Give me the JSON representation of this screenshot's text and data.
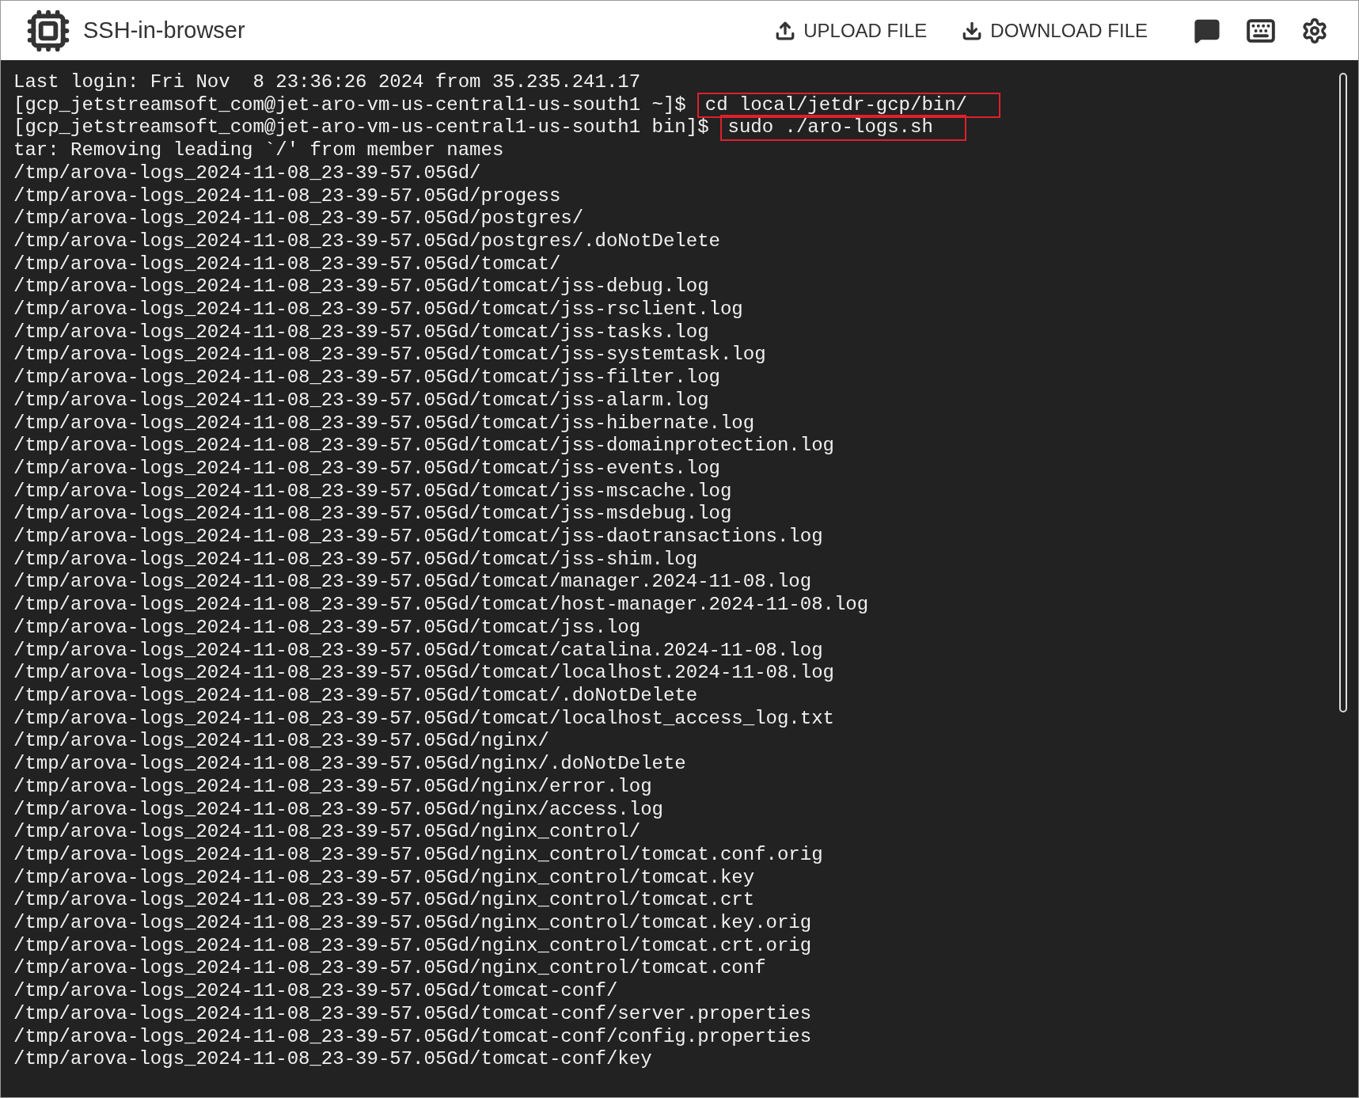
{
  "header": {
    "title": "SSH-in-browser",
    "actions": [
      {
        "kind": "upload",
        "label": "UPLOAD FILE"
      },
      {
        "kind": "download",
        "label": "DOWNLOAD FILE"
      }
    ],
    "icon_buttons": [
      {
        "kind": "feedback"
      },
      {
        "kind": "keyboard"
      },
      {
        "kind": "settings"
      }
    ]
  },
  "terminal": {
    "lines": [
      {
        "kind": "output",
        "text": "Last login: Fri Nov  8 23:36:26 2024 from 35.235.241.17"
      },
      {
        "kind": "prompt",
        "prompt": "[gcp_jetstreamsoft_com@jet-aro-vm-us-central1-us-south1 ~]$",
        "command": "cd local/jetdr-gcp/bin/",
        "highlighted": true
      },
      {
        "kind": "prompt",
        "prompt": "[gcp_jetstreamsoft_com@jet-aro-vm-us-central1-us-south1 bin]$",
        "command": "sudo ./aro-logs.sh",
        "highlighted": true
      },
      {
        "kind": "output",
        "text": "tar: Removing leading `/' from member names"
      },
      {
        "kind": "output",
        "text": "/tmp/arova-logs_2024-11-08_23-39-57.05Gd/"
      },
      {
        "kind": "output",
        "text": "/tmp/arova-logs_2024-11-08_23-39-57.05Gd/progess"
      },
      {
        "kind": "output",
        "text": "/tmp/arova-logs_2024-11-08_23-39-57.05Gd/postgres/"
      },
      {
        "kind": "output",
        "text": "/tmp/arova-logs_2024-11-08_23-39-57.05Gd/postgres/.doNotDelete"
      },
      {
        "kind": "output",
        "text": "/tmp/arova-logs_2024-11-08_23-39-57.05Gd/tomcat/"
      },
      {
        "kind": "output",
        "text": "/tmp/arova-logs_2024-11-08_23-39-57.05Gd/tomcat/jss-debug.log"
      },
      {
        "kind": "output",
        "text": "/tmp/arova-logs_2024-11-08_23-39-57.05Gd/tomcat/jss-rsclient.log"
      },
      {
        "kind": "output",
        "text": "/tmp/arova-logs_2024-11-08_23-39-57.05Gd/tomcat/jss-tasks.log"
      },
      {
        "kind": "output",
        "text": "/tmp/arova-logs_2024-11-08_23-39-57.05Gd/tomcat/jss-systemtask.log"
      },
      {
        "kind": "output",
        "text": "/tmp/arova-logs_2024-11-08_23-39-57.05Gd/tomcat/jss-filter.log"
      },
      {
        "kind": "output",
        "text": "/tmp/arova-logs_2024-11-08_23-39-57.05Gd/tomcat/jss-alarm.log"
      },
      {
        "kind": "output",
        "text": "/tmp/arova-logs_2024-11-08_23-39-57.05Gd/tomcat/jss-hibernate.log"
      },
      {
        "kind": "output",
        "text": "/tmp/arova-logs_2024-11-08_23-39-57.05Gd/tomcat/jss-domainprotection.log"
      },
      {
        "kind": "output",
        "text": "/tmp/arova-logs_2024-11-08_23-39-57.05Gd/tomcat/jss-events.log"
      },
      {
        "kind": "output",
        "text": "/tmp/arova-logs_2024-11-08_23-39-57.05Gd/tomcat/jss-mscache.log"
      },
      {
        "kind": "output",
        "text": "/tmp/arova-logs_2024-11-08_23-39-57.05Gd/tomcat/jss-msdebug.log"
      },
      {
        "kind": "output",
        "text": "/tmp/arova-logs_2024-11-08_23-39-57.05Gd/tomcat/jss-daotransactions.log"
      },
      {
        "kind": "output",
        "text": "/tmp/arova-logs_2024-11-08_23-39-57.05Gd/tomcat/jss-shim.log"
      },
      {
        "kind": "output",
        "text": "/tmp/arova-logs_2024-11-08_23-39-57.05Gd/tomcat/manager.2024-11-08.log"
      },
      {
        "kind": "output",
        "text": "/tmp/arova-logs_2024-11-08_23-39-57.05Gd/tomcat/host-manager.2024-11-08.log"
      },
      {
        "kind": "output",
        "text": "/tmp/arova-logs_2024-11-08_23-39-57.05Gd/tomcat/jss.log"
      },
      {
        "kind": "output",
        "text": "/tmp/arova-logs_2024-11-08_23-39-57.05Gd/tomcat/catalina.2024-11-08.log"
      },
      {
        "kind": "output",
        "text": "/tmp/arova-logs_2024-11-08_23-39-57.05Gd/tomcat/localhost.2024-11-08.log"
      },
      {
        "kind": "output",
        "text": "/tmp/arova-logs_2024-11-08_23-39-57.05Gd/tomcat/.doNotDelete"
      },
      {
        "kind": "output",
        "text": "/tmp/arova-logs_2024-11-08_23-39-57.05Gd/tomcat/localhost_access_log.txt"
      },
      {
        "kind": "output",
        "text": "/tmp/arova-logs_2024-11-08_23-39-57.05Gd/nginx/"
      },
      {
        "kind": "output",
        "text": "/tmp/arova-logs_2024-11-08_23-39-57.05Gd/nginx/.doNotDelete"
      },
      {
        "kind": "output",
        "text": "/tmp/arova-logs_2024-11-08_23-39-57.05Gd/nginx/error.log"
      },
      {
        "kind": "output",
        "text": "/tmp/arova-logs_2024-11-08_23-39-57.05Gd/nginx/access.log"
      },
      {
        "kind": "output",
        "text": "/tmp/arova-logs_2024-11-08_23-39-57.05Gd/nginx_control/"
      },
      {
        "kind": "output",
        "text": "/tmp/arova-logs_2024-11-08_23-39-57.05Gd/nginx_control/tomcat.conf.orig"
      },
      {
        "kind": "output",
        "text": "/tmp/arova-logs_2024-11-08_23-39-57.05Gd/nginx_control/tomcat.key"
      },
      {
        "kind": "output",
        "text": "/tmp/arova-logs_2024-11-08_23-39-57.05Gd/nginx_control/tomcat.crt"
      },
      {
        "kind": "output",
        "text": "/tmp/arova-logs_2024-11-08_23-39-57.05Gd/nginx_control/tomcat.key.orig"
      },
      {
        "kind": "output",
        "text": "/tmp/arova-logs_2024-11-08_23-39-57.05Gd/nginx_control/tomcat.crt.orig"
      },
      {
        "kind": "output",
        "text": "/tmp/arova-logs_2024-11-08_23-39-57.05Gd/nginx_control/tomcat.conf"
      },
      {
        "kind": "output",
        "text": "/tmp/arova-logs_2024-11-08_23-39-57.05Gd/tomcat-conf/"
      },
      {
        "kind": "output",
        "text": "/tmp/arova-logs_2024-11-08_23-39-57.05Gd/tomcat-conf/server.properties"
      },
      {
        "kind": "output",
        "text": "/tmp/arova-logs_2024-11-08_23-39-57.05Gd/tomcat-conf/config.properties"
      },
      {
        "kind": "output",
        "text": "/tmp/arova-logs_2024-11-08_23-39-57.05Gd/tomcat-conf/key"
      }
    ]
  }
}
